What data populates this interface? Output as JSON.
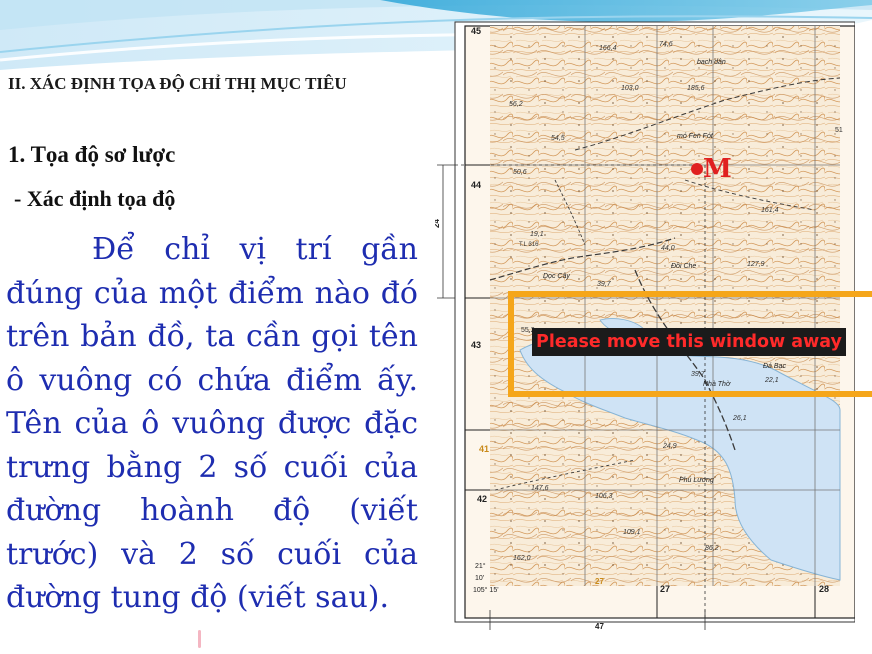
{
  "slide": {
    "heading": "II. XÁC ĐỊNH TỌA ĐỘ CHỈ THỊ MỤC TIÊU",
    "subheading": "1. Tọa độ sơ lược",
    "bullet": "- Xác định tọa độ",
    "paragraph": "Để chỉ vị trí gần đúng của một điểm nào đó trên bản đồ, ta cần gọi tên ô vuông có chứa điểm ấy. Tên của ô vuông được đặc trưng bằng 2 số cuối của đường hoành độ (viết trước) và 2 số cuối của đường tung độ (viết sau)."
  },
  "map": {
    "grid_labels_y": [
      "45",
      "44",
      "43",
      "42",
      "41"
    ],
    "grid_labels_x": [
      "27",
      "28"
    ],
    "marker_label": "M",
    "dimension_vertical": "24",
    "dimension_horizontal": "47",
    "corner_lat": "21°",
    "corner_min": "10'",
    "corner_lon": "105° 15'",
    "place_names": [
      "bach dân",
      "mó Fen Fót",
      "Đồi Che",
      "Dọc Cây",
      "Phú Lương",
      "Nhà Thờ",
      "Đá Bạc"
    ],
    "elevations": [
      "166,4",
      "74,6",
      "103,0",
      "185,6",
      "56,2",
      "54,5",
      "50,6",
      "161,4",
      "19,1",
      "44,0",
      "127,9",
      "39,7",
      "39,7",
      "22,1",
      "26,1",
      "24,9",
      "147,6",
      "106,3",
      "109,1",
      "162,0",
      "86,2"
    ],
    "misc_labels": [
      "T.L 316",
      "55,2",
      "27",
      "51"
    ]
  },
  "overlay": {
    "message": "Please move this window away"
  },
  "colors": {
    "body_text": "#1e2db0",
    "overlay_border": "#f5a61a",
    "overlay_text": "#ff2a2a",
    "map_contour": "#c98a4c",
    "map_water": "#cfe3f5",
    "marker": "#e02020"
  }
}
